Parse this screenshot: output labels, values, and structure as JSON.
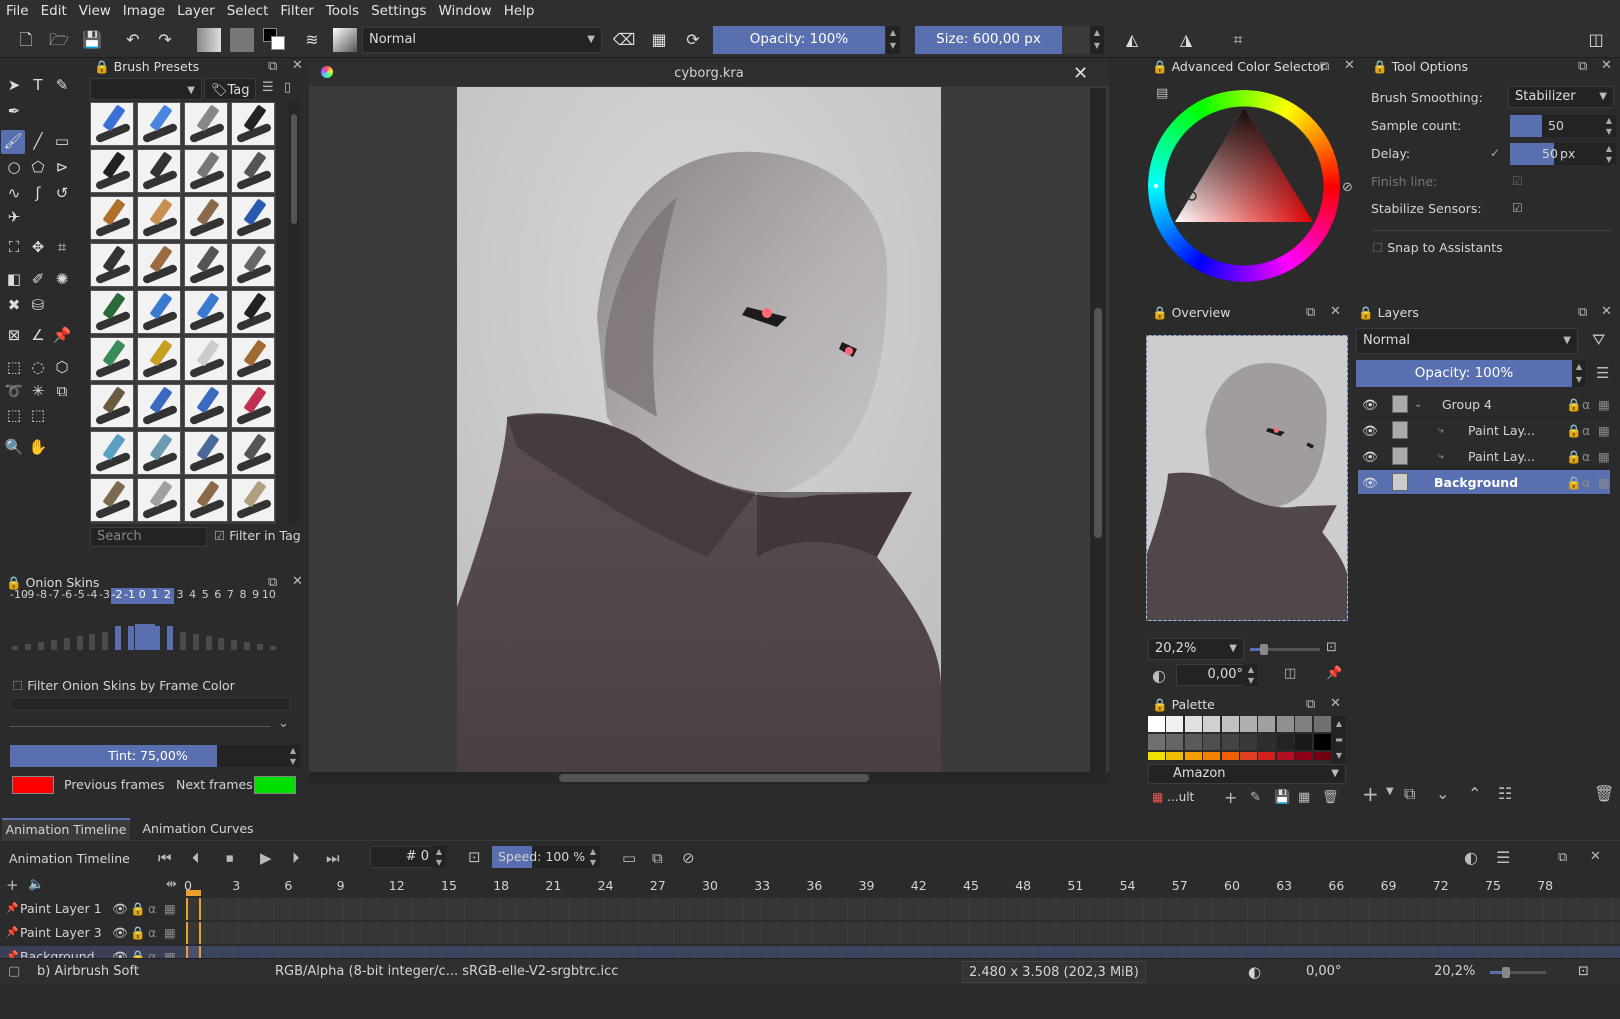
{
  "menu": [
    "File",
    "Edit",
    "View",
    "Image",
    "Layer",
    "Select",
    "Filter",
    "Tools",
    "Settings",
    "Window",
    "Help"
  ],
  "toolbar": {
    "blend_mode": "Normal",
    "opacity_label": "Opacity: 100%",
    "size_label": "Size: 600,00 px"
  },
  "brush_presets": {
    "title": "Brush Presets",
    "tag_label": "Tag",
    "search_placeholder": "Search",
    "filter_in_tag": "Filter in Tag"
  },
  "document": {
    "title": "cyborg.kra"
  },
  "onion_skins": {
    "title": "Onion Skins",
    "frames": [
      "-10",
      "-9",
      "-8",
      "-7",
      "-6",
      "-5",
      "-4",
      "-3",
      "-2",
      "-1",
      "0",
      "1",
      "2",
      "3",
      "4",
      "5",
      "6",
      "7",
      "8",
      "9",
      "10"
    ],
    "filter_label": "Filter Onion Skins by Frame Color",
    "tint_label": "Tint: 75,00%",
    "tint_value": 0.75,
    "previous_label": "Previous frames",
    "next_label": "Next frames",
    "previous_color": "#ff0000",
    "next_color": "#00e000"
  },
  "color_selector": {
    "title": "Advanced Color Selector"
  },
  "tool_options": {
    "title": "Tool Options",
    "brush_smoothing_label": "Brush Smoothing:",
    "brush_smoothing_value": "Stabilizer",
    "sample_count_label": "Sample count:",
    "sample_count_value": "50",
    "delay_label": "Delay:",
    "delay_value": "50",
    "delay_unit": "px",
    "finish_line_label": "Finish line:",
    "stabilize_sensors_label": "Stabilize Sensors:",
    "snap_label": "Snap to Assistants"
  },
  "overview": {
    "title": "Overview",
    "zoom": "20,2%",
    "rotation": "0,00°"
  },
  "palette": {
    "title": "Palette",
    "name": "Amazon",
    "set_label": "...ult"
  },
  "layers": {
    "title": "Layers",
    "blend_mode": "Normal",
    "opacity_label": "Opacity:  100%",
    "items": [
      {
        "name": "Group 4"
      },
      {
        "name": "Paint Lay..."
      },
      {
        "name": "Paint Lay..."
      },
      {
        "name": "Background"
      }
    ]
  },
  "timeline": {
    "tabs": [
      "Animation Timeline",
      "Animation Curves"
    ],
    "title": "Animation Timeline",
    "frame_value": "# 0",
    "speed_label": "Speed: 100 %",
    "ruler": [
      "0",
      "3",
      "6",
      "9",
      "12",
      "15",
      "18",
      "21",
      "24",
      "27",
      "30",
      "33",
      "36",
      "39",
      "42",
      "45",
      "48",
      "51",
      "54",
      "57",
      "60",
      "63",
      "66",
      "69",
      "72",
      "75",
      "78"
    ],
    "layers": [
      "Paint Layer 1",
      "Paint Layer 3",
      "Background"
    ]
  },
  "status": {
    "brush": "b) Airbrush Soft",
    "color_space": "RGB/Alpha (8-bit integer/c...  sRGB-elle-V2-srgbtrc.icc",
    "dimensions": "2.480 x 3.508 (202,3 MiB)",
    "rotation": "0,00°",
    "zoom": "20,2%"
  },
  "colors": {
    "accent": "#5a6fb0",
    "panel_bg": "#2b2b2b",
    "canvas_bg": "#c9c9c9"
  }
}
